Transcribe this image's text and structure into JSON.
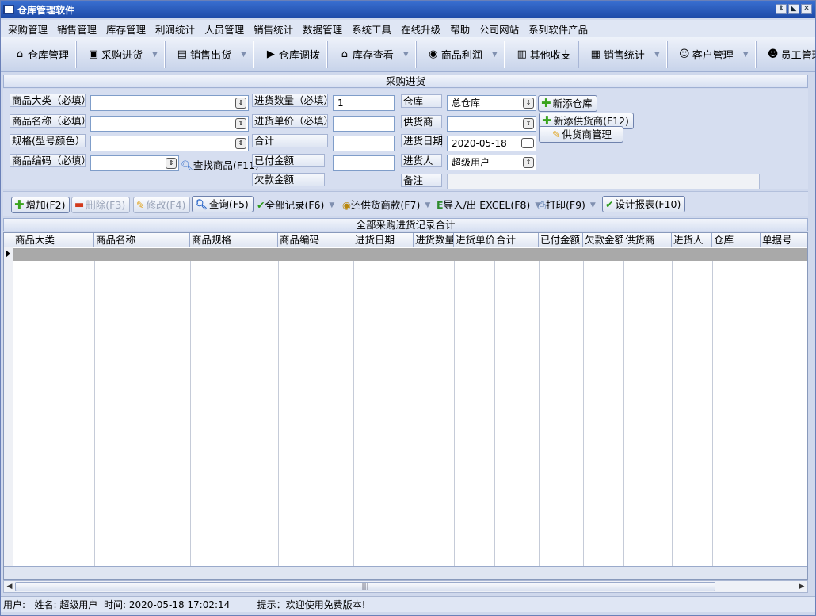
{
  "window": {
    "title": "仓库管理软件"
  },
  "menu": [
    "采购管理",
    "销售管理",
    "库存管理",
    "利润统计",
    "人员管理",
    "销售统计",
    "数据管理",
    "系统工具",
    "在线升级",
    "帮助",
    "公司网站",
    "系列软件产品"
  ],
  "toolbar": [
    {
      "label": "仓库管理",
      "icon": "house-icon",
      "glyph": "🏠",
      "drop": false
    },
    {
      "label": "采购进货",
      "icon": "purchase-icon",
      "glyph": "🛒",
      "drop": true
    },
    {
      "label": "销售出货",
      "icon": "sales-icon",
      "glyph": "📋",
      "drop": true
    },
    {
      "label": "仓库调拨",
      "icon": "transfer-icon",
      "glyph": "🚚",
      "drop": false
    },
    {
      "label": "库存查看",
      "icon": "inventory-icon",
      "glyph": "🏠",
      "drop": true
    },
    {
      "label": "商品利润",
      "icon": "money-bag-icon",
      "glyph": "💰",
      "drop": true
    },
    {
      "label": "其他收支",
      "icon": "ledger-icon",
      "glyph": "📒",
      "drop": false
    },
    {
      "label": "销售统计",
      "icon": "chart-icon",
      "glyph": "📊",
      "drop": true
    },
    {
      "label": "客户管理",
      "icon": "customers-icon",
      "glyph": "👥",
      "drop": true
    },
    {
      "label": "员工管理",
      "icon": "staff-icon",
      "glyph": "👥",
      "drop": false
    }
  ],
  "section_title": "采购进货",
  "form": {
    "category_label": "商品大类（必填）",
    "name_label": "商品名称（必填）",
    "spec_label": "规格(型号颜色）",
    "code_label": "商品编码（必填）",
    "find_label": "查找商品(F11)",
    "qty_label": "进货数量（必填）",
    "qty_value": "1",
    "price_label": "进货单价（必填）",
    "total_label": "合计",
    "paid_label": "已付金额",
    "owed_label": "欠款金额",
    "warehouse_label": "仓库",
    "warehouse_value": "总仓库",
    "supplier_label": "供货商",
    "date_label": "进货日期",
    "date_value": "2020-05-18",
    "buyer_label": "进货人",
    "buyer_value": "超级用户",
    "note_label": "备注",
    "new_warehouse": "新添仓库",
    "new_supplier": "新添供货商(F12)",
    "supplier_mgmt": "供货商管理"
  },
  "actions": {
    "add": "增加(F2)",
    "delete": "删除(F3)",
    "edit": "修改(F4)",
    "query": "查询(F5)",
    "all": "全部记录(F6)",
    "repay": "还供货商款(F7)",
    "excel": "导入/出 EXCEL(F8)",
    "print": "打印(F9)",
    "report": "设计报表(F10)"
  },
  "grid_title": "全部采购进货记录合计",
  "columns": [
    "商品大类",
    "商品名称",
    "商品规格",
    "商品编码",
    "进货日期",
    "进货数量",
    "进货单价",
    "合计",
    "已付金额",
    "欠款金额",
    "供货商",
    "进货人",
    "仓库",
    "单据号"
  ],
  "status": {
    "user": "用户:",
    "name": "姓名: 超级用户",
    "time": "时间: 2020-05-18 17:02:14",
    "hint": "提示：欢迎使用免费版本!"
  }
}
